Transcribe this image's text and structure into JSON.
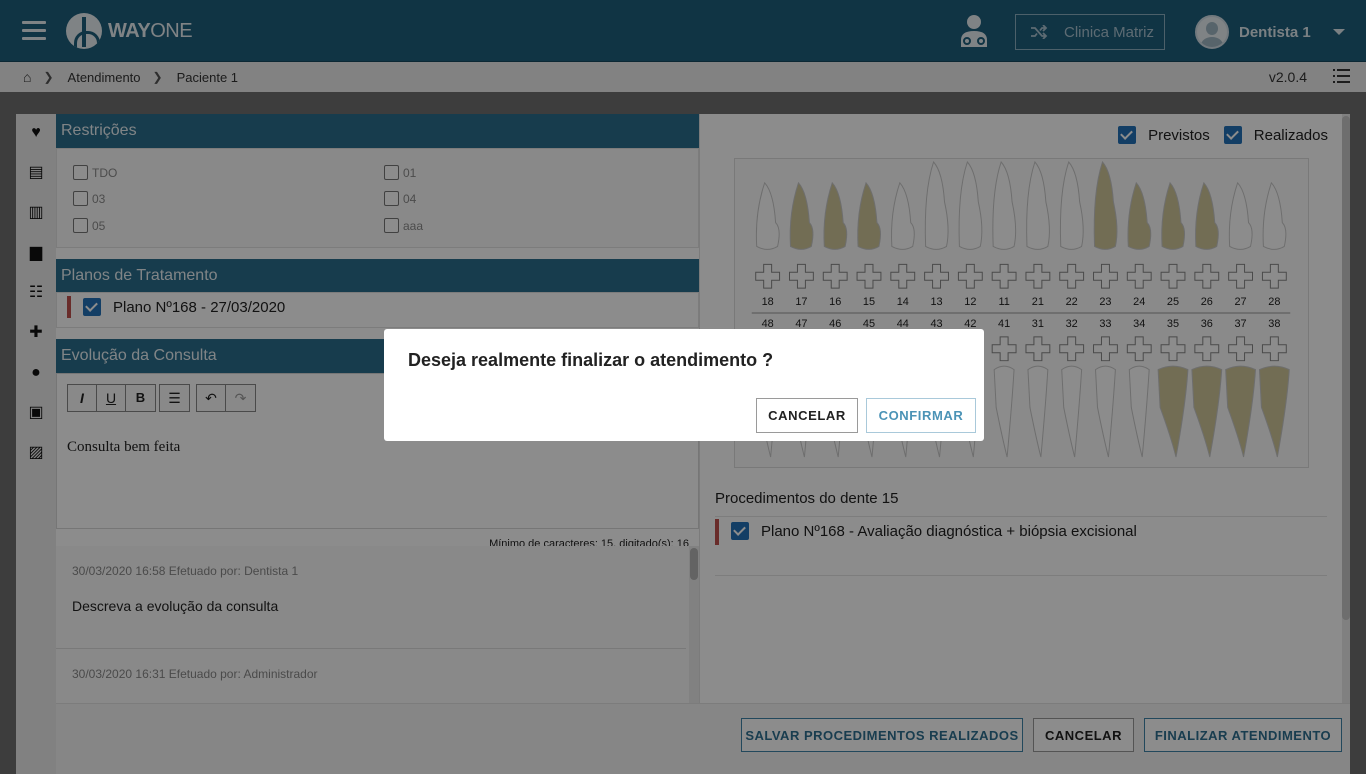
{
  "header": {
    "logo_way": "WAY",
    "logo_one": "ONE",
    "clinic": "Clinica Matriz",
    "user": "Dentista 1"
  },
  "breadcrumb": {
    "items": [
      "Atendimento",
      "Paciente 1"
    ]
  },
  "version": "v2.0.4",
  "restricoes": {
    "title": "Restrições",
    "options": [
      "TDO",
      "03",
      "05",
      "01",
      "04",
      "aaa"
    ]
  },
  "planos": {
    "title": "Planos de Tratamento",
    "item": "Plano Nº168 - 27/03/2020"
  },
  "evolucao": {
    "title": "Evolução da Consulta",
    "toolbar": [
      "I",
      "U",
      "B"
    ],
    "text": "Consulta bem feita",
    "min_chars": "Mínimo de caracteres: 15, digitado(s): 16"
  },
  "history": [
    {
      "meta": "30/03/2020 16:58 Efetuado por: Dentista 1",
      "text": "Descreva a evolução da consulta"
    },
    {
      "meta": "30/03/2020 16:31 Efetuado por: Administrador",
      "text": ""
    }
  ],
  "odontogram": {
    "toggle_previstos": "Previstos",
    "toggle_realizados": "Realizados",
    "upper_teeth": [
      "18",
      "17",
      "16",
      "15",
      "14",
      "13",
      "12",
      "11",
      "21",
      "22",
      "23",
      "24",
      "25",
      "26",
      "27",
      "28"
    ],
    "lower_teeth": [
      "48",
      "47",
      "46",
      "45",
      "44",
      "43",
      "42",
      "41",
      "31",
      "32",
      "33",
      "34",
      "35",
      "36",
      "37",
      "38"
    ],
    "highlighted_upper": [
      "17",
      "16",
      "15",
      "23",
      "24",
      "25",
      "26"
    ],
    "highlighted_lower": [
      "35",
      "36",
      "37",
      "38"
    ]
  },
  "procedimentos": {
    "title": "Procedimentos do dente 15",
    "item": "Plano Nº168 - Avaliação diagnóstica + biópsia excisional"
  },
  "footer": {
    "save": "SALVAR PROCEDIMENTOS REALIZADOS",
    "cancel": "CANCELAR",
    "finish": "FINALIZAR ATENDIMENTO"
  },
  "modal": {
    "title": "Deseja realmente finalizar o atendimento ?",
    "cancel": "CANCELAR",
    "confirm": "CONFIRMAR"
  },
  "colors": {
    "header": "#1e5f7c",
    "section": "#2a6d8c",
    "accent": "#2372b8",
    "tooth": "#ffffff",
    "tooth_highlight": "#cfc79a"
  }
}
